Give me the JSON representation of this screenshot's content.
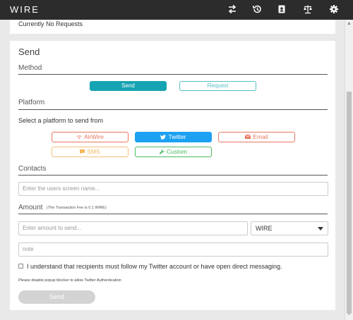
{
  "topbar": {
    "logo": "WIRE",
    "icons": [
      "transfer-icon",
      "history-icon",
      "contacts-icon",
      "balance-icon",
      "gear-icon"
    ]
  },
  "requests": {
    "status": "Currently No Requests"
  },
  "send_card": {
    "title": "Send",
    "method": {
      "label": "Method",
      "send_label": "Send",
      "request_label": "Request"
    },
    "platform": {
      "label": "Platform",
      "instruction": "Select a platform to send from",
      "options": {
        "airwire": "AirWire",
        "twitter": "Twitter",
        "email": "Email",
        "sms": "SMS",
        "custom": "Custom"
      },
      "selected": "Twitter"
    },
    "contacts": {
      "label": "Contacts",
      "placeholder": "Enter the users screen name..."
    },
    "amount": {
      "label": "Amount",
      "fee_note": "(The Transaction Fee is 0.1 WIRE)",
      "placeholder": "Enter amount to send...",
      "currency": "WIRE"
    },
    "note": {
      "placeholder": "note"
    },
    "consent": {
      "label": "I understand that recipients must follow my Twitter account or have open direct messaging.",
      "checked": false
    },
    "popup_note": "Please disable popup blocker to allow Twitter Authentication",
    "submit_label": "Send"
  },
  "colors": {
    "accent": "#16a3b3",
    "twitter": "#1da1f2",
    "airwire": "#e8775f",
    "sms": "#f0b65a",
    "custom": "#4cb961",
    "topbar": "#2c2c2c"
  }
}
